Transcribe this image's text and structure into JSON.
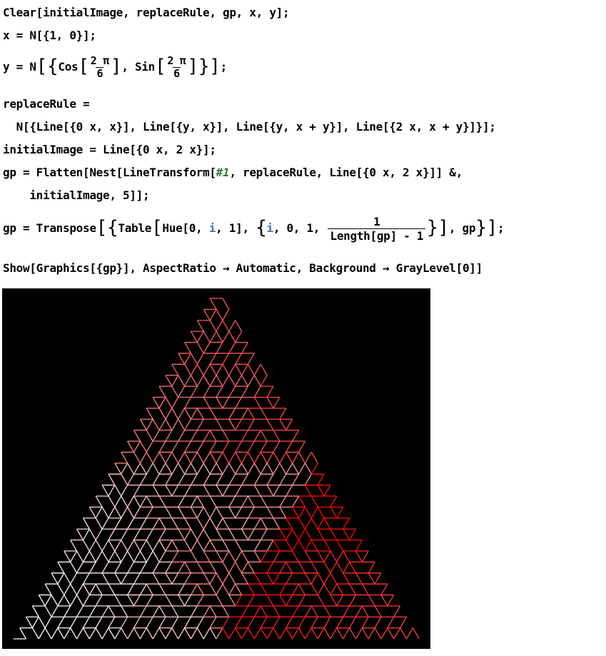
{
  "code": {
    "line1": "Clear[initialImage, replaceRule, gp, x, y];",
    "line2": "x = N[{1, 0}];",
    "line3": {
      "pre": "y = N",
      "cos": "Cos",
      "sin": "Sin",
      "frac_num": "2 π",
      "frac_den": "6",
      "comma": ", ",
      "end": ";"
    },
    "line4": "replaceRule =",
    "line5": "  N[{Line[{0 x, x}], Line[{y, x}], Line[{y, x + y}], Line[{2 x, x + y}]}];",
    "line6": "initialImage = Line[{0 x, 2 x}];",
    "line7_pre": "gp = Flatten[Nest[LineTransform[",
    "line7_slot": "#1",
    "line7_post": ", replaceRule, Line[{0 x, 2 x}]] &,",
    "line8": "    initialImage, 5]];",
    "line9": {
      "pre": "gp = Transpose",
      "table": "Table",
      "hue_pre": "Hue[0, ",
      "iter_i": "i",
      "hue_post": ", 1], ",
      "range_pre": ", 0, 1, ",
      "frac_num": "1",
      "frac_den": "Length[gp] - 1",
      "post": ", gp",
      "end": ";"
    },
    "line10": "Show[Graphics[{gp}], AspectRatio → Automatic, Background → GrayLevel[0]]"
  },
  "graphic": {
    "background": "#000000",
    "line_hue": 0,
    "saturation_from": 0,
    "saturation_to": 1,
    "depth": 5
  }
}
